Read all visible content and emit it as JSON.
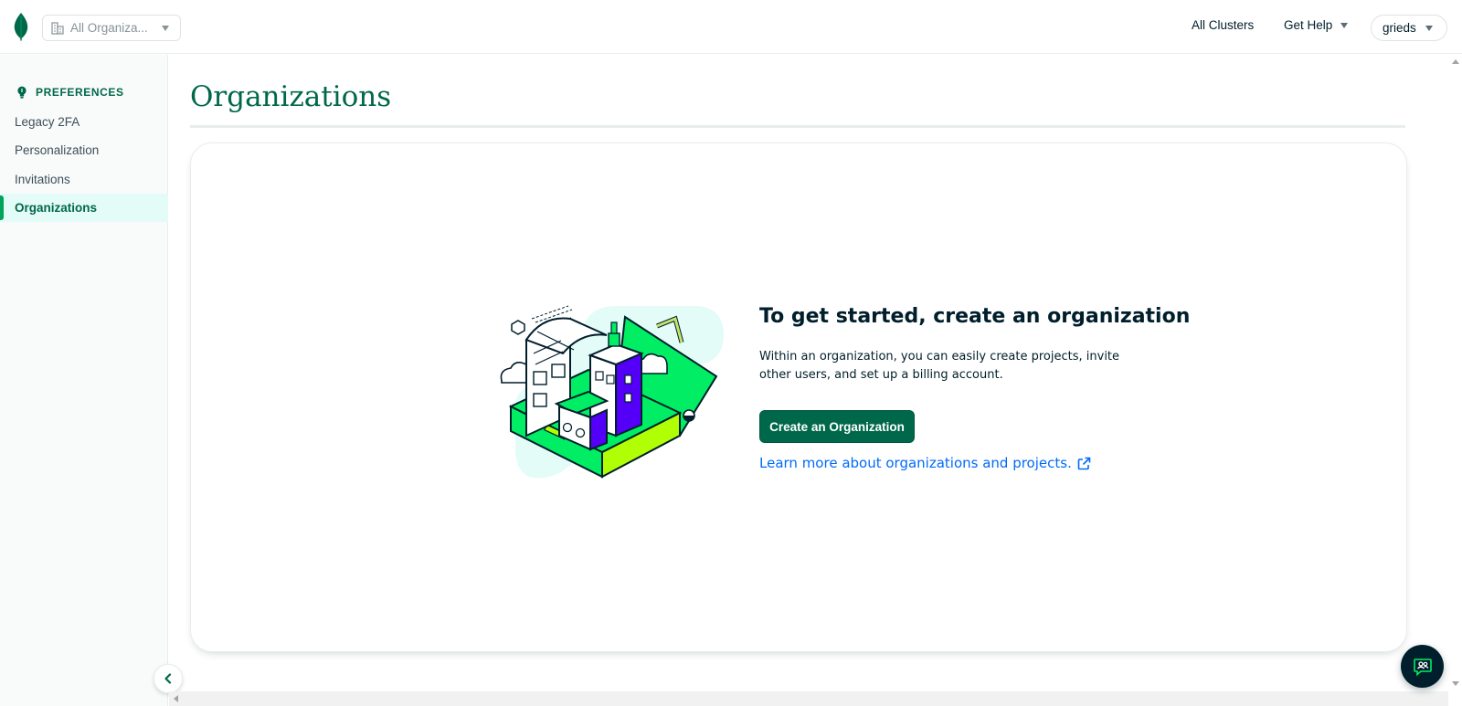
{
  "topbar": {
    "org_selector": "All Organiza...",
    "all_clusters": "All Clusters",
    "get_help": "Get Help",
    "user": "grieds"
  },
  "sidebar": {
    "section_title": "PREFERENCES",
    "items": [
      {
        "label": "Legacy 2FA",
        "active": false
      },
      {
        "label": "Personalization",
        "active": false
      },
      {
        "label": "Invitations",
        "active": false
      },
      {
        "label": "Organizations",
        "active": true
      }
    ]
  },
  "main": {
    "title": "Organizations",
    "empty_state": {
      "heading": "To get started, create an organization",
      "description": "Within an organization, you can easily create projects, invite other users, and set up a billing account.",
      "button": "Create an Organization",
      "link": "Learn more about organizations and projects."
    }
  },
  "colors": {
    "brand_green": "#00684a",
    "accent_green": "#00ed64",
    "link_blue": "#016bf8",
    "active_bg": "#e3fcf7"
  },
  "icons": [
    "leaf-logo-icon",
    "building-icon",
    "chevron-down-icon",
    "lightbulb-icon",
    "chevron-left-icon",
    "external-link-icon",
    "chat-support-icon"
  ]
}
